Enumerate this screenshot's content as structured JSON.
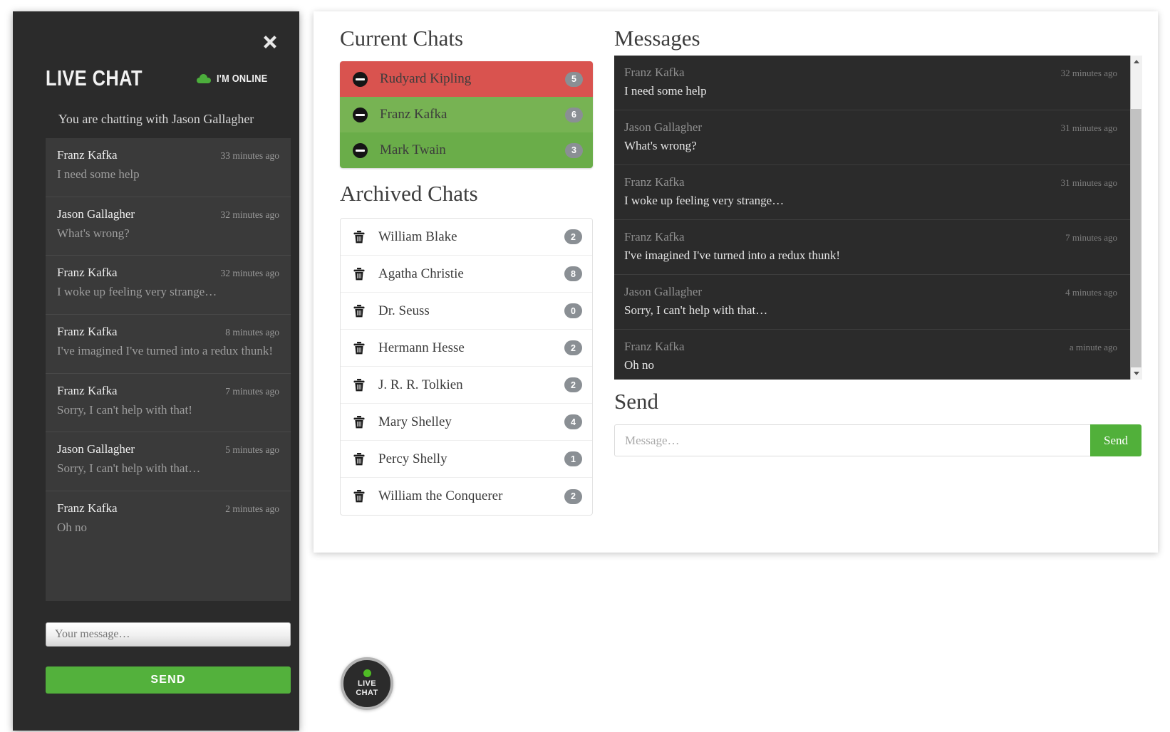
{
  "widget": {
    "title": "LIVE CHAT",
    "status_text": "I'M ONLINE",
    "subtitle": "You are chatting with Jason Gallagher",
    "close_label": "✕",
    "input_placeholder": "Your message…",
    "input_value": "",
    "send_label": "SEND",
    "messages": [
      {
        "author": "Franz Kafka",
        "time": "33 minutes ago",
        "body": "I need some help"
      },
      {
        "author": "Jason Gallagher",
        "time": "32 minutes ago",
        "body": "What's wrong?"
      },
      {
        "author": "Franz Kafka",
        "time": "32 minutes ago",
        "body": "I woke up feeling very strange…"
      },
      {
        "author": "Franz Kafka",
        "time": "8 minutes ago",
        "body": "I've imagined I've turned into a redux thunk!"
      },
      {
        "author": "Franz Kafka",
        "time": "7 minutes ago",
        "body": "Sorry, I can't help with that!"
      },
      {
        "author": "Jason Gallagher",
        "time": "5 minutes ago",
        "body": "Sorry, I can't help with that…"
      },
      {
        "author": "Franz Kafka",
        "time": "2 minutes ago",
        "body": "Oh no"
      }
    ]
  },
  "current_chats": {
    "title": "Current Chats",
    "items": [
      {
        "name": "Rudyard Kipling",
        "count": "5",
        "state": "red"
      },
      {
        "name": "Franz Kafka",
        "count": "6",
        "state": "green"
      },
      {
        "name": "Mark Twain",
        "count": "3",
        "state": "green-dark"
      }
    ]
  },
  "archived_chats": {
    "title": "Archived Chats",
    "items": [
      {
        "name": "William Blake",
        "count": "2"
      },
      {
        "name": "Agatha Christie",
        "count": "8"
      },
      {
        "name": "Dr. Seuss",
        "count": "0"
      },
      {
        "name": "Hermann Hesse",
        "count": "2"
      },
      {
        "name": "J. R. R. Tolkien",
        "count": "2"
      },
      {
        "name": "Mary Shelley",
        "count": "4"
      },
      {
        "name": "Percy Shelly",
        "count": "1"
      },
      {
        "name": "William the Conquerer",
        "count": "2"
      }
    ]
  },
  "messages_panel": {
    "title": "Messages",
    "items": [
      {
        "author": "Franz Kafka",
        "time": "32 minutes ago",
        "body": "I need some help"
      },
      {
        "author": "Jason Gallagher",
        "time": "31 minutes ago",
        "body": "What's wrong?"
      },
      {
        "author": "Franz Kafka",
        "time": "31 minutes ago",
        "body": "I woke up feeling very strange…"
      },
      {
        "author": "Franz Kafka",
        "time": "7 minutes ago",
        "body": "I've imagined I've turned into a redux thunk!"
      },
      {
        "author": "Jason Gallagher",
        "time": "4 minutes ago",
        "body": "Sorry, I can't help with that…"
      },
      {
        "author": "Franz Kafka",
        "time": "a minute ago",
        "body": "Oh no"
      }
    ]
  },
  "send": {
    "title": "Send",
    "placeholder": "Message…",
    "value": "",
    "button_label": "Send"
  },
  "fab": {
    "line1": "LIVE",
    "line2": "CHAT"
  },
  "colors": {
    "accent_green": "#53b13c",
    "danger_red": "#d9534f",
    "chat_green": "#77b353",
    "badge_gray": "#8a8f94",
    "dark_bg": "#2b2b2b"
  }
}
